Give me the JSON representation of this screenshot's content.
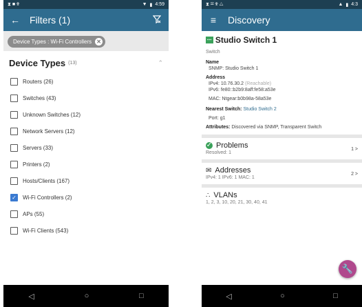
{
  "left": {
    "status": {
      "left_icons": "⧗ ■ ✠",
      "time": "4:59"
    },
    "appbar": {
      "title": "Filters (1)"
    },
    "chip": {
      "label": "Device Types : Wi-Fi Controllers"
    },
    "section": {
      "title": "Device Types",
      "count": "(13)"
    },
    "options": [
      {
        "label": "Routers (26)",
        "checked": false
      },
      {
        "label": "Switches (43)",
        "checked": false
      },
      {
        "label": "Unknown Switches (12)",
        "checked": false
      },
      {
        "label": "Network Servers (12)",
        "checked": false
      },
      {
        "label": "Servers (33)",
        "checked": false
      },
      {
        "label": "Printers (2)",
        "checked": false
      },
      {
        "label": "Hosts/Clients (167)",
        "checked": false
      },
      {
        "label": "Wi-Fi Controllers (2)",
        "checked": true
      },
      {
        "label": "APs (55)",
        "checked": false
      },
      {
        "label": "Wi-Fi Clients (543)",
        "checked": false
      }
    ]
  },
  "right": {
    "status": {
      "left_icons": "⧗ ✉ ✠ △",
      "time": "4:3"
    },
    "appbar": {
      "title": "Discovery"
    },
    "device": {
      "badge": "▪▪▪",
      "name": "Studio Switch 1",
      "type": "Switch",
      "name_label": "Name",
      "snmp_name": "SNMP: Studio Switch 1",
      "address_label": "Address",
      "ipv4": "IPv4: 10.76.30.2",
      "reachable": "(Reachable)",
      "ipv6": "IPv6: fe80::b2b9:8aff:fe58:a53e",
      "mac": "MAC: Ntgear:b0b98a-58a53e",
      "nearest_label": "Nearest Switch:",
      "nearest_value": "Studio Switch 2",
      "port": "Port: g1",
      "attributes_label": "Attributes:",
      "attributes_value": "Discovered via SNMP, Transparent Switch"
    },
    "problems": {
      "title": "Problems",
      "sub": "Resolved: 1",
      "right": "1 >"
    },
    "addresses": {
      "title": "Addresses",
      "sub": "IPv4: 1   IPv6: 1   MAC: 1",
      "right": "2 >"
    },
    "vlans": {
      "title": "VLANs",
      "sub": "1, 2, 3, 10, 20, 21, 30, 40, 41"
    }
  }
}
